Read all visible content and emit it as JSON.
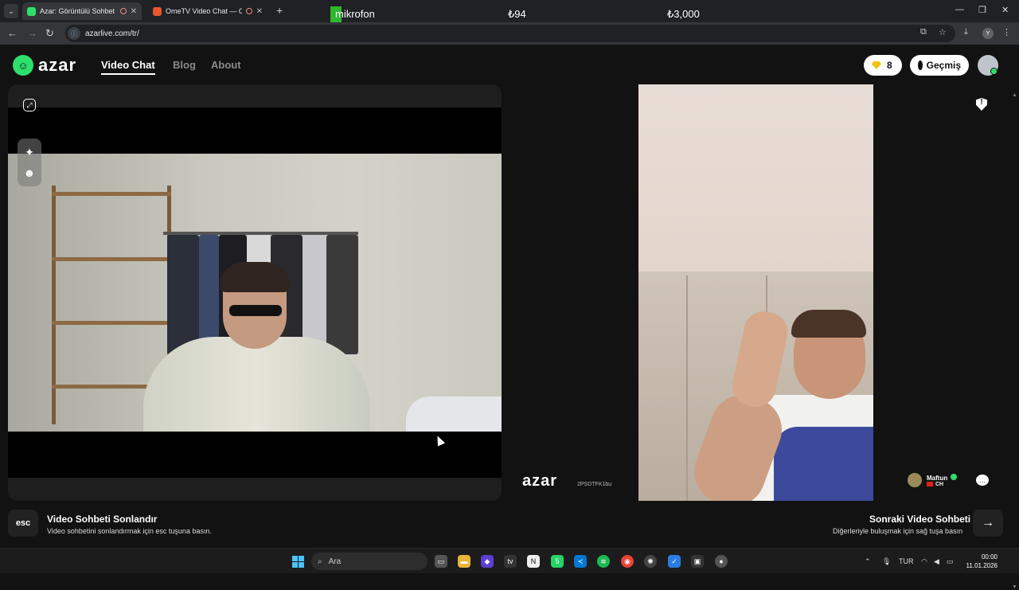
{
  "browser": {
    "tabs": [
      {
        "title": "Azar: Görüntülü Sohbet & Y",
        "active": true
      },
      {
        "title": "OmeTV Video Chat — Ome",
        "active": false
      }
    ],
    "url": "azarlive.com/tr/",
    "profile_initial": "Y"
  },
  "overlay": {
    "mic_label": "mikrofon",
    "stat_1": "₺94",
    "stat_2": "₺3,000"
  },
  "header": {
    "logo_text": "azar",
    "nav": [
      "Video Chat",
      "Blog",
      "About"
    ],
    "gems": "8",
    "history_label": "Geçmiş"
  },
  "remote": {
    "watermark": "azar",
    "code": "2PSDTFK1bu",
    "peer_name": "Maftun",
    "peer_country": "CH"
  },
  "footer": {
    "esc_key": "esc",
    "end_title": "Video Sohbeti Sonlandır",
    "end_sub": "Video sohbetini sonlandırmak için esc tuşuna basın.",
    "next_title": "Sonraki Video Sohbeti",
    "next_sub": "Diğerleriyle buluşmak için sağ tuşa basın"
  },
  "taskbar": {
    "search_placeholder": "Ara",
    "whatsapp_badge": "5",
    "lang": "TUR",
    "time": "00:00",
    "date": "11.01.2026"
  },
  "colors": {
    "brand_green": "#2ee06b",
    "gem_yellow": "#f4c20d",
    "background": "#121212"
  }
}
